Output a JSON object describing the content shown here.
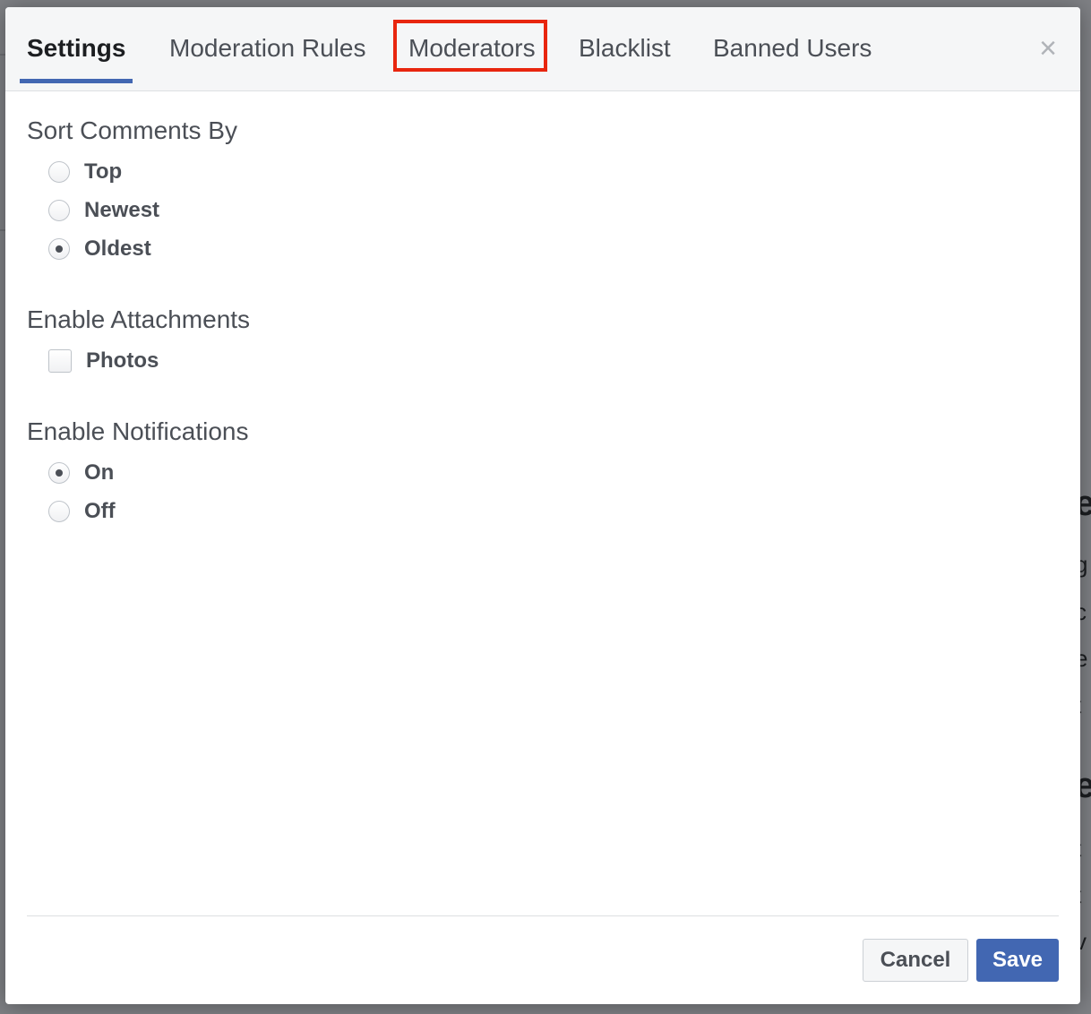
{
  "tabs": [
    {
      "label": "Settings",
      "active": true
    },
    {
      "label": "Moderation Rules",
      "active": false
    },
    {
      "label": "Moderators",
      "active": false,
      "highlighted": true
    },
    {
      "label": "Blacklist",
      "active": false
    },
    {
      "label": "Banned Users",
      "active": false
    }
  ],
  "close_icon": "×",
  "sections": {
    "sort": {
      "title": "Sort Comments By",
      "options": [
        {
          "label": "Top",
          "checked": false
        },
        {
          "label": "Newest",
          "checked": false
        },
        {
          "label": "Oldest",
          "checked": true
        }
      ]
    },
    "attachments": {
      "title": "Enable Attachments",
      "options": [
        {
          "label": "Photos",
          "checked": false
        }
      ]
    },
    "notifications": {
      "title": "Enable Notifications",
      "options": [
        {
          "label": "On",
          "checked": true
        },
        {
          "label": "Off",
          "checked": false
        }
      ]
    }
  },
  "footer": {
    "cancel_label": "Cancel",
    "save_label": "Save"
  },
  "colors": {
    "accent": "#4267b2",
    "highlight": "#e8260f"
  }
}
